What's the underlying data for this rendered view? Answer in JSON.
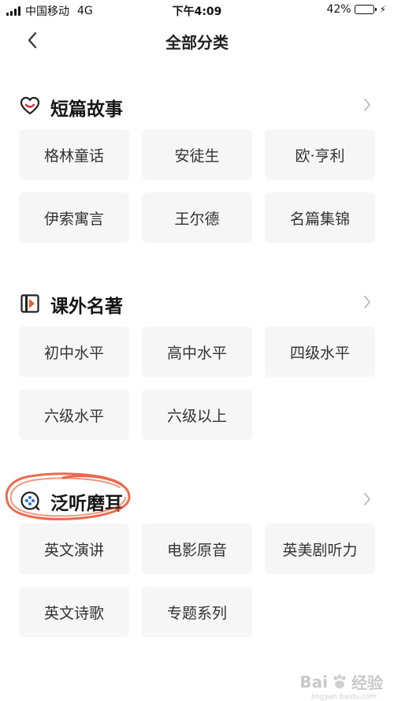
{
  "status_bar": {
    "carrier": "中国移动",
    "network": "4G",
    "time": "下午4:09",
    "battery_percent_label": "42%",
    "battery_level": 0.42
  },
  "nav": {
    "title": "全部分类",
    "back_icon": "chevron-left-icon"
  },
  "sections": [
    {
      "title": "短篇故事",
      "icon": "heart-smile-icon",
      "icon_color": "#e8323c",
      "items": [
        "格林童话",
        "安徒生",
        "欧·亨利",
        "伊索寓言",
        "王尔德",
        "名篇集锦"
      ]
    },
    {
      "title": "课外名著",
      "icon": "book-icon",
      "icon_color": "#f15a24",
      "items": [
        "初中水平",
        "高中水平",
        "四级水平",
        "六级水平",
        "六级以上"
      ]
    },
    {
      "title": "泛听磨耳",
      "icon": "headphone-dots-icon",
      "icon_color": "#2f6fe0",
      "items": [
        "英文演讲",
        "电影原音",
        "英美剧听力",
        "英文诗歌",
        "专题系列"
      ]
    }
  ],
  "colors": {
    "chip_bg": "#f6f6f6",
    "annotation_circle": "#e8502f",
    "chevron": "#bbbbbb"
  },
  "watermark": {
    "brand": "Bai",
    "brand_suffix": "经验",
    "url": "jingyan.baidu.com"
  }
}
